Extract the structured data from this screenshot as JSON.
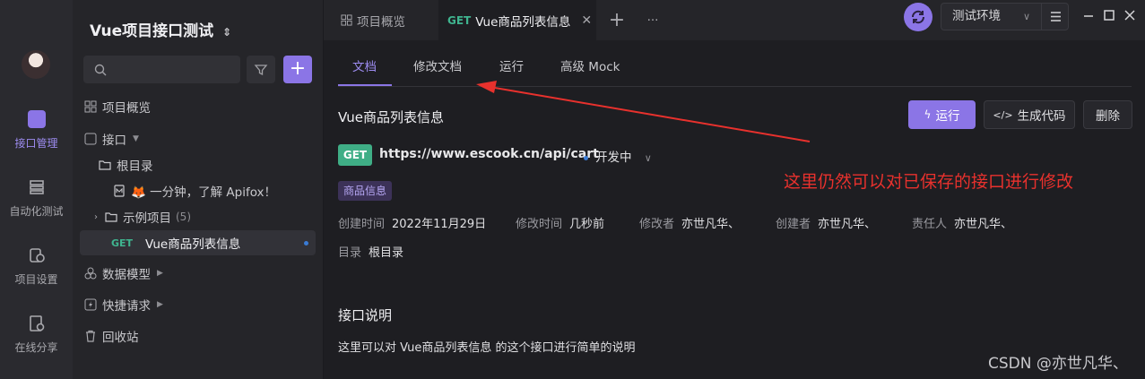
{
  "rail": {
    "items": [
      {
        "label": "接口管理",
        "icon": "api-manage-icon",
        "active": true
      },
      {
        "label": "自动化测试",
        "icon": "automation-test-icon",
        "active": false
      },
      {
        "label": "项目设置",
        "icon": "project-settings-icon",
        "active": false
      },
      {
        "label": "在线分享",
        "icon": "online-share-icon",
        "active": false
      }
    ]
  },
  "sidebar": {
    "project_title": "Vue项目接口测试",
    "tree": {
      "overview": "项目概览",
      "api": "接口",
      "root": "根目录",
      "doc": "🦊 一分钟，了解 Apifox！",
      "examples": "示例项目",
      "examples_count": "(5)",
      "selected_method": "GET",
      "selected_name": "Vue商品列表信息",
      "models": "数据模型",
      "quick": "快捷请求",
      "trash": "回收站"
    }
  },
  "tabs": {
    "overview": "项目概览",
    "active_method": "GET",
    "active_label": "Vue商品列表信息",
    "more": "···"
  },
  "env": {
    "selected": "测试环境"
  },
  "subtabs": [
    "文档",
    "修改文档",
    "运行",
    "高级 Mock"
  ],
  "api": {
    "title": "Vue商品列表信息",
    "method": "GET",
    "url": "https://www.escook.cn/api/cart",
    "status": "开发中",
    "tag": "商品信息",
    "run_label": "运行",
    "gen_code_label": "生成代码",
    "delete_label": "删除",
    "meta": {
      "created_time_k": "创建时间",
      "created_time_v": "2022年11月29日",
      "modified_time_k": "修改时间",
      "modified_time_v": "几秒前",
      "modifier_k": "修改者",
      "modifier_v": "亦世凡华、",
      "creator_k": "创建者",
      "creator_v": "亦世凡华、",
      "owner_k": "责任人",
      "owner_v": "亦世凡华、",
      "dir_k": "目录",
      "dir_v": "根目录"
    },
    "section_title": "接口说明",
    "description": "这里可以对 Vue商品列表信息 的这个接口进行简单的说明"
  },
  "annotation": "这里仍然可以对已保存的接口进行修改",
  "watermark": "CSDN @亦世凡华、",
  "colors": {
    "accent": "#8b75e6",
    "get": "#3fae86",
    "annotation": "#e8312d"
  }
}
